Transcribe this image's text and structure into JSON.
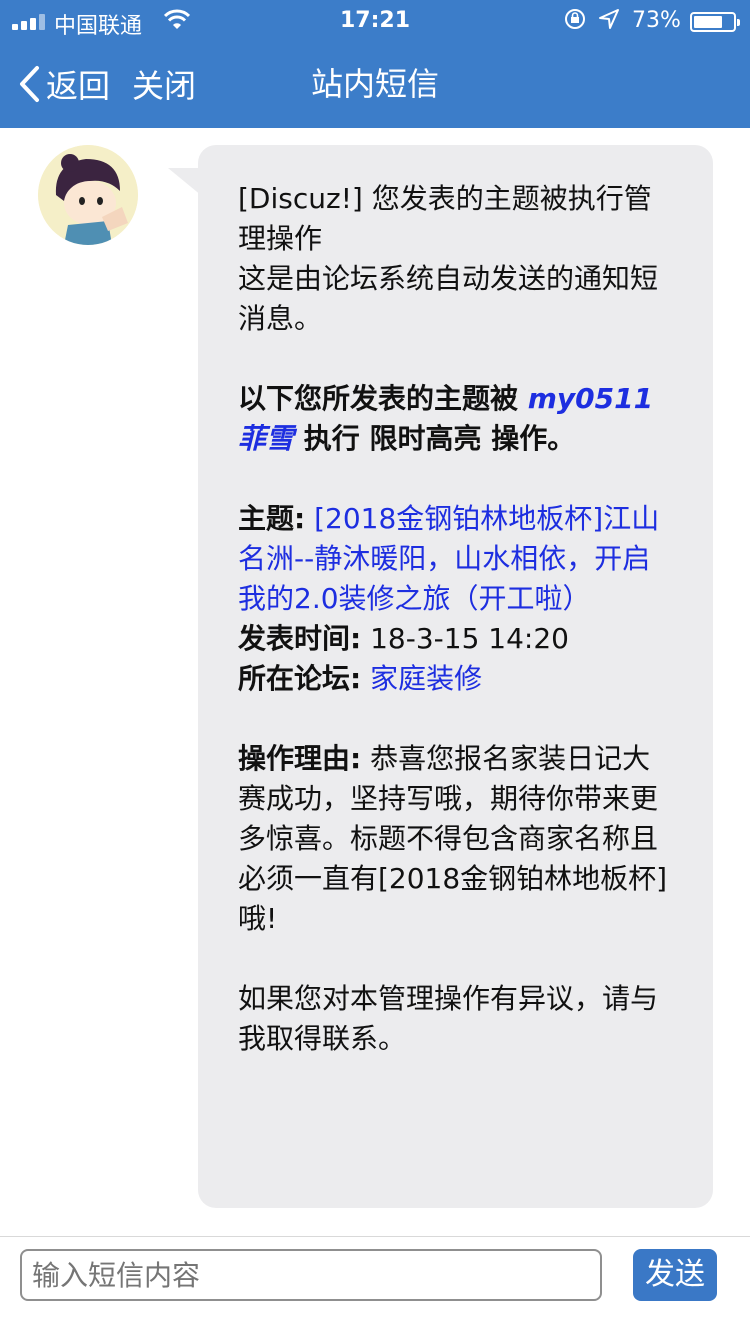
{
  "status_bar": {
    "carrier": "中国联通",
    "time": "17:21",
    "battery_percent": "73%",
    "battery_level": 0.73
  },
  "nav": {
    "back_label": "返回",
    "close_label": "关闭",
    "title": "站内短信"
  },
  "message": {
    "line1": "[Discuz!] 您发表的主题被执行管理操作",
    "line2": "这是由论坛系统自动发送的通知短消息。",
    "notice_prefix": "以下您所发表的主题被 ",
    "operator": "my0511菲雪",
    "notice_mid": " 执行 ",
    "operation": "限时高亮",
    "notice_suffix": " 操作。",
    "subject_label": "主题:",
    "subject_value": "[2018金钢铂林地板杯]江山名洲--静沐暖阳，山水相依，开启我的2.0装修之旅（开工啦）",
    "time_label": "发表时间:",
    "time_value": "18-3-15 14:20",
    "forum_label": "所在论坛:",
    "forum_value": "家庭装修",
    "reason_label": "操作理由:",
    "reason_value": "恭喜您报名家装日记大赛成功，坚持写哦，期待你带来更多惊喜。标题不得包含商家名称且必须一直有[2018金钢铂林地板杯]哦!",
    "footer": "如果您对本管理操作有异议，请与我取得联系。"
  },
  "input_bar": {
    "placeholder": "输入短信内容",
    "send_label": "发送"
  },
  "colors": {
    "nav_bg": "#3c7dc9",
    "bubble_bg": "#ececee",
    "link_blue": "#1d2ee0",
    "send_bg": "#3a78c6"
  }
}
